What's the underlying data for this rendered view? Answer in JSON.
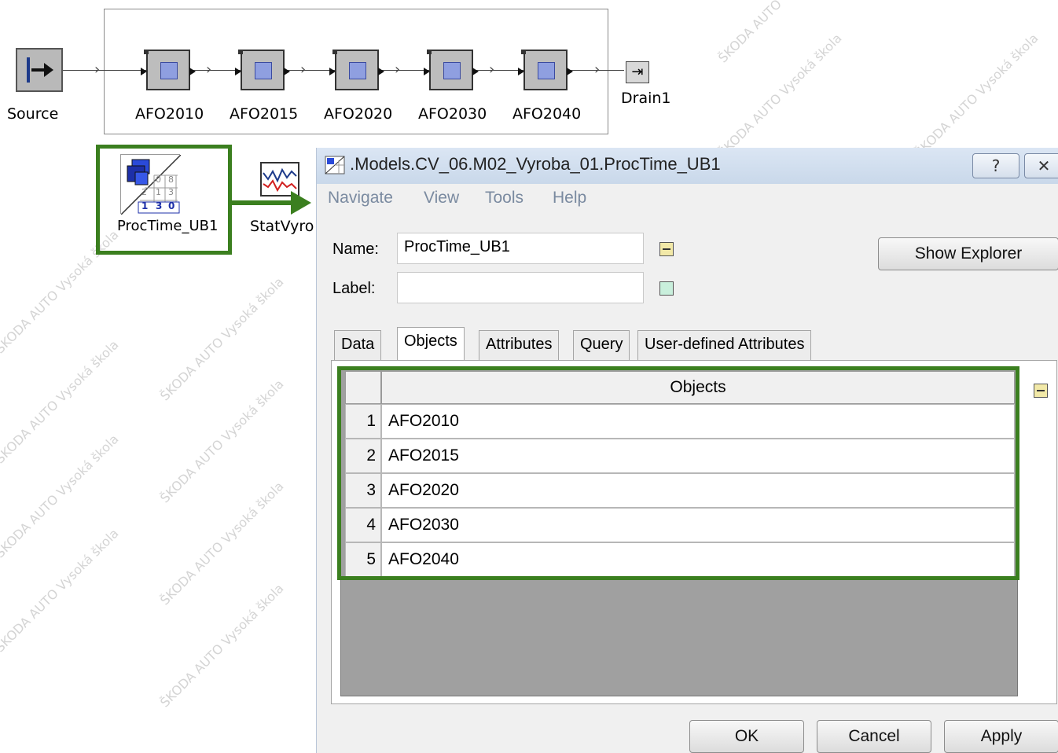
{
  "watermark_text": "ŠKODA AUTO Vysoká škola",
  "model": {
    "source_label": "Source",
    "drain_label": "Drain1",
    "stations": [
      "AFO2010",
      "AFO2015",
      "AFO2020",
      "AFO2030",
      "AFO2040"
    ],
    "table_label": "ProcTime_UB1",
    "table_digits": [
      "0",
      "8",
      "2",
      "1",
      "3",
      "1",
      "3",
      "0"
    ],
    "stat_label": "StatVyro"
  },
  "dialog": {
    "title": ".Models.CV_06.M02_Vyroba_01.ProcTime_UB1",
    "help_button": "?",
    "close_button": "✕",
    "menu": [
      "Navigate",
      "View",
      "Tools",
      "Help"
    ],
    "name_label": "Name:",
    "name_value": "ProcTime_UB1",
    "label_label": "Label:",
    "label_value": "",
    "show_explorer": "Show Explorer",
    "tabs": [
      "Data",
      "Objects",
      "Attributes",
      "Query",
      "User-defined Attributes"
    ],
    "grid_header": "Objects",
    "rows": [
      {
        "num": "1",
        "value": "AFO2010"
      },
      {
        "num": "2",
        "value": "AFO2015"
      },
      {
        "num": "3",
        "value": "AFO2020"
      },
      {
        "num": "4",
        "value": "AFO2030"
      },
      {
        "num": "5",
        "value": "AFO2040"
      }
    ],
    "ok": "OK",
    "cancel": "Cancel",
    "apply": "Apply"
  },
  "colors": {
    "highlight_green": "#3b7f1f",
    "station_blue": "#8f9fe0"
  }
}
